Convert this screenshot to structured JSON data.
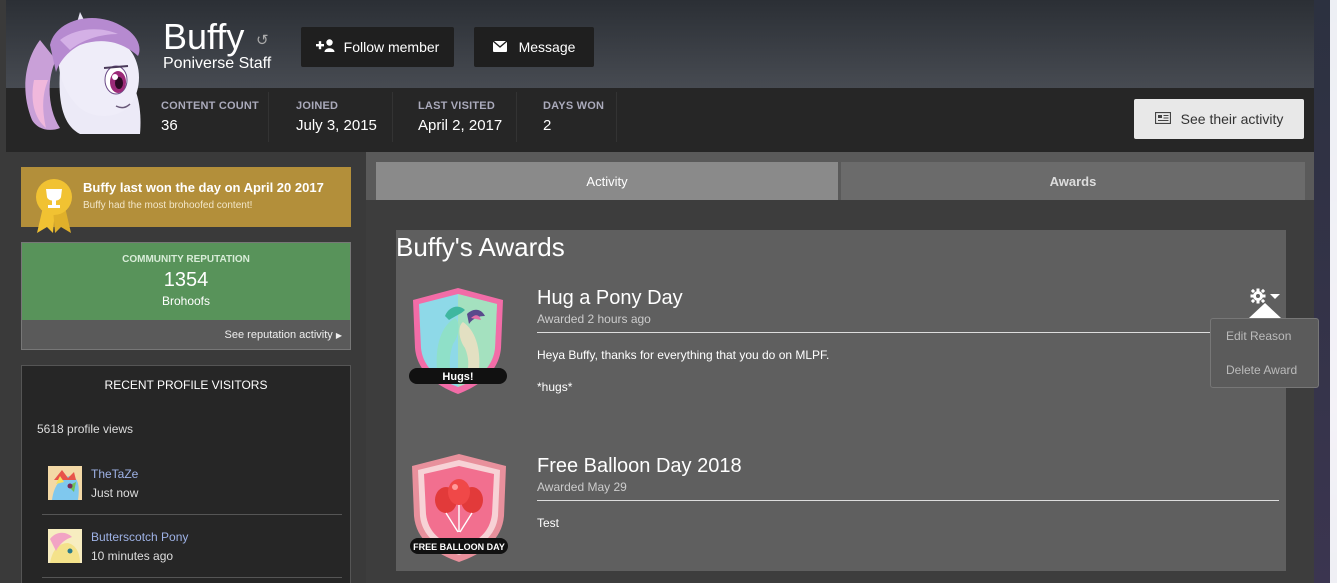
{
  "profile": {
    "username": "Buffy",
    "usergroup": "Poniverse Staff",
    "follow_label": "Follow member",
    "message_label": "Message",
    "activity_label": "See their activity",
    "stats": [
      {
        "label": "CONTENT COUNT",
        "value": "36"
      },
      {
        "label": "JOINED",
        "value": "July 3, 2015"
      },
      {
        "label": "LAST VISITED",
        "value": "April 2, 2017"
      },
      {
        "label": "DAYS WON",
        "value": "2"
      }
    ]
  },
  "day_award": {
    "title": "Buffy last won the day on April 20 2017",
    "subtitle": "Buffy had the most brohoofed content!"
  },
  "reputation": {
    "label": "COMMUNITY REPUTATION",
    "value": "1354",
    "unit": "Brohoofs",
    "link": "See reputation activity"
  },
  "visitors": {
    "title": "RECENT PROFILE VISITORS",
    "views": "5618 profile views",
    "items": [
      {
        "name": "TheTaZe",
        "time": "Just now"
      },
      {
        "name": "Butterscotch Pony",
        "time": "10 minutes ago"
      }
    ]
  },
  "tabs": [
    {
      "label": "Activity"
    },
    {
      "label": "Awards"
    }
  ],
  "awards": {
    "heading": "Buffy's Awards",
    "items": [
      {
        "title": "Hug a Pony Day",
        "date": "Awarded 2 hours ago",
        "text": [
          "Heya Buffy, thanks for everything that you do on MLPF.",
          "*hugs*"
        ],
        "badge_text": "Hugs!"
      },
      {
        "title": "Free Balloon Day 2018",
        "date": "Awarded May 29",
        "text": [
          "Test"
        ],
        "badge_text": "FREE BALLOON DAY"
      }
    ],
    "menu": {
      "edit_label": "Edit Reason",
      "delete_label": "Delete Award"
    }
  },
  "colors": {
    "award_day": "#b38f3a",
    "reputation": "#58935a",
    "visitor_link": "#9eb2e6"
  }
}
